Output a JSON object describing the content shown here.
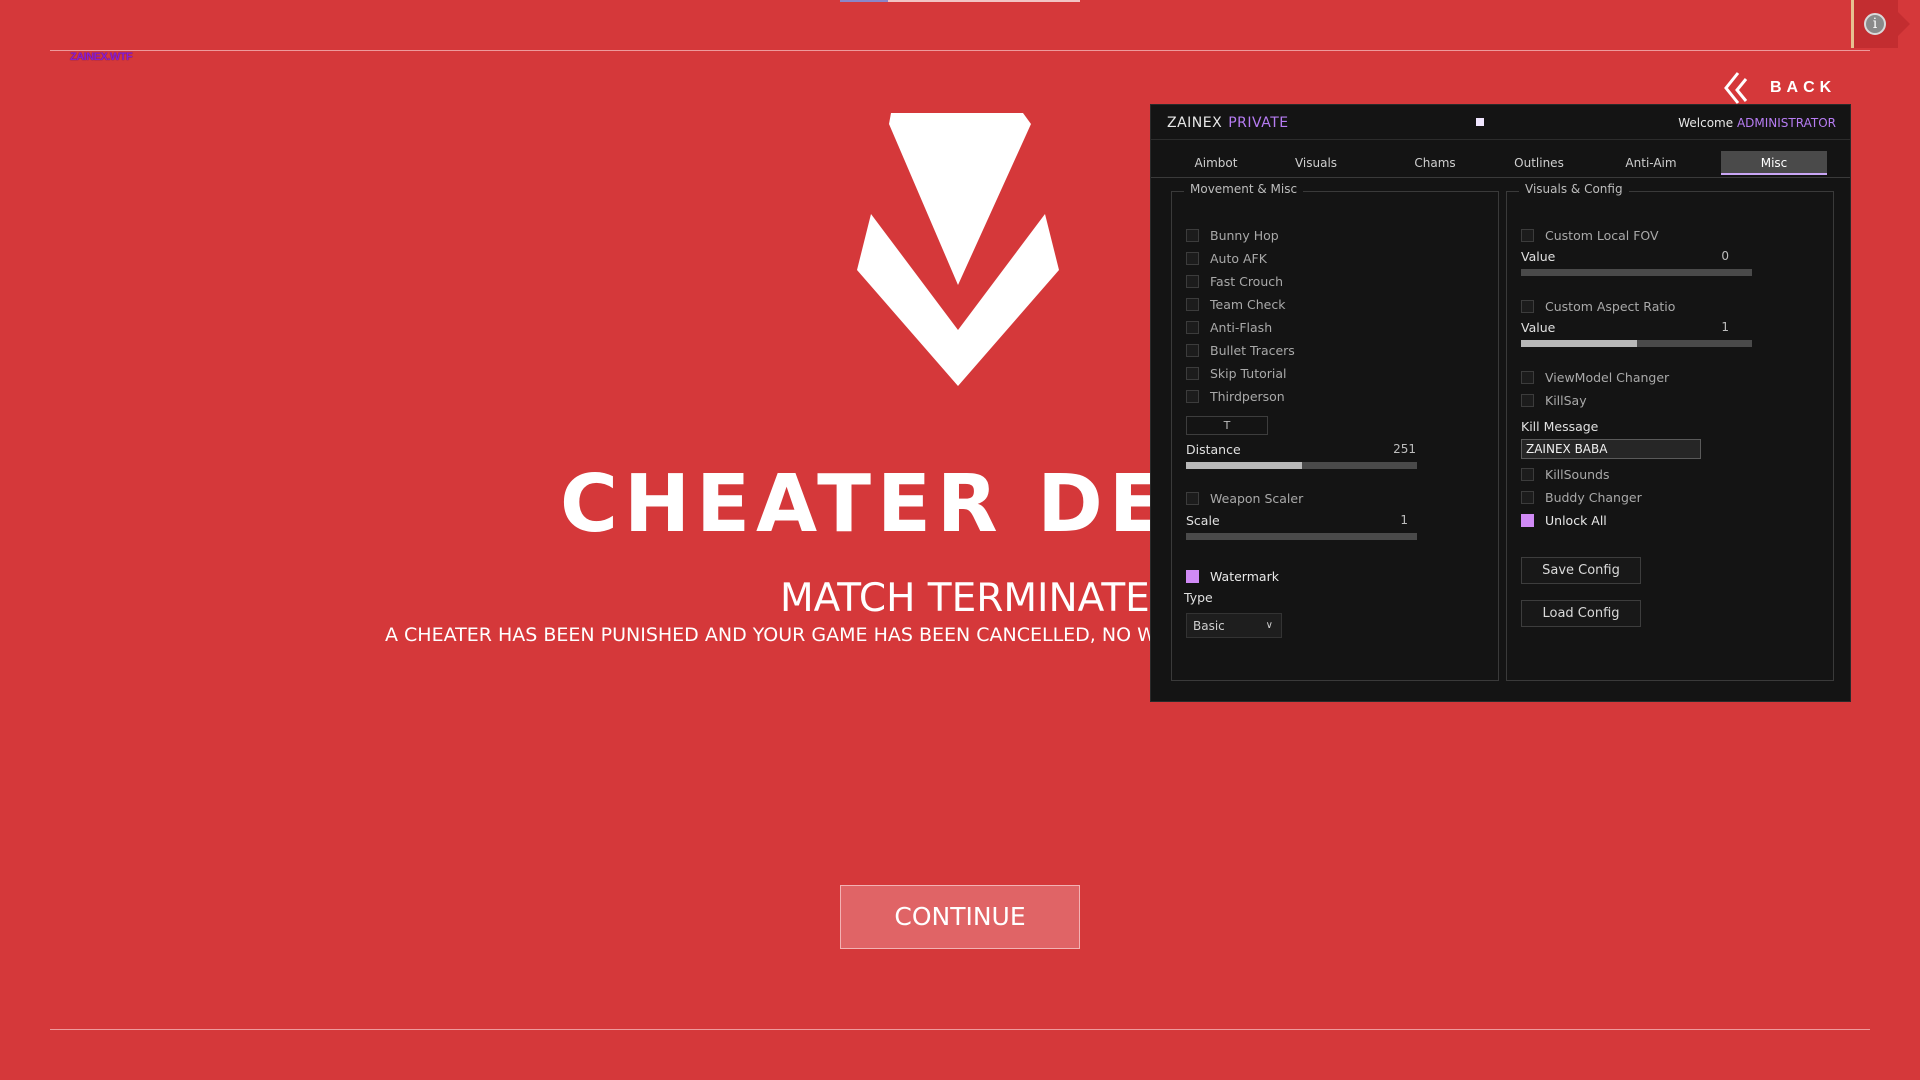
{
  "watermark": "ZAINEX.WTF",
  "info_icon": "i",
  "back": {
    "label": "BACK",
    "icon": "double-chevron-left-icon"
  },
  "hero": {
    "headline": "CHEATER DETE",
    "subhead": "MATCH TERMINATED",
    "description": "A CHEATER HAS BEEN PUNISHED AND YOUR GAME HAS BEEN CANCELLED, NO WIN OR LC",
    "continue": "CONTINUE"
  },
  "menu": {
    "brand": "ZAINEX",
    "tier": "PRIVATE",
    "welcome": "Welcome",
    "user": "ADMINISTRATOR",
    "tabs": [
      {
        "label": "Aimbot"
      },
      {
        "label": "Visuals"
      },
      {
        "label": "Chams"
      },
      {
        "label": "Outlines"
      },
      {
        "label": "Anti-Aim"
      },
      {
        "label": "Misc",
        "active": true
      }
    ],
    "left": {
      "title": "Movement & Misc",
      "checkboxes": [
        {
          "label": "Bunny Hop",
          "checked": false
        },
        {
          "label": "Auto AFK",
          "checked": false
        },
        {
          "label": "Fast Crouch",
          "checked": false
        },
        {
          "label": "Team Check",
          "checked": false
        },
        {
          "label": "Anti-Flash",
          "checked": false
        },
        {
          "label": "Bullet Tracers",
          "checked": false
        },
        {
          "label": "Skip Tutorial",
          "checked": false
        },
        {
          "label": "Thirdperson",
          "checked": false
        }
      ],
      "thirdperson_key": "T",
      "distance": {
        "label": "Distance",
        "value": "251",
        "fraction": 0.5
      },
      "weapon_scaler": {
        "label": "Weapon Scaler",
        "checked": false
      },
      "scale": {
        "label": "Scale",
        "value": "1",
        "fraction": 0.0
      },
      "watermark_cb": {
        "label": "Watermark",
        "checked": true
      },
      "type_label": "Type",
      "type_value": "Basic"
    },
    "right": {
      "title": "Visuals & Config",
      "custom_fov": {
        "label": "Custom Local FOV",
        "checked": false
      },
      "fov_value": {
        "label": "Value",
        "value": "0",
        "fraction": 0.0
      },
      "aspect": {
        "label": "Custom Aspect Ratio",
        "checked": false
      },
      "aspect_value": {
        "label": "Value",
        "value": "1",
        "fraction": 0.5
      },
      "viewmodel": {
        "label": "ViewModel Changer",
        "checked": false
      },
      "killsay": {
        "label": "KillSay",
        "checked": false
      },
      "kill_message_label": "Kill Message",
      "kill_message": "ZAINEX BABA",
      "killsounds": {
        "label": "KillSounds",
        "checked": false
      },
      "buddy": {
        "label": "Buddy Changer",
        "checked": false
      },
      "unlock_all": {
        "label": "Unlock All",
        "checked": true
      },
      "save_config": "Save Config",
      "load_config": "Load Config"
    }
  }
}
